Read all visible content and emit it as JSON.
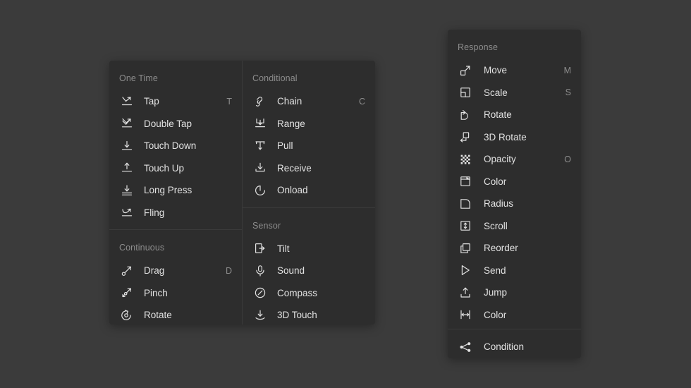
{
  "theme": {
    "background": "#3b3b3b",
    "panel": "#2d2d2d",
    "divider": "#3b3b3b",
    "label_color": "#e2e2e2",
    "muted_color": "#8d8d8d",
    "icon_color": "#e2e2e2"
  },
  "left_panel": {
    "columns": [
      {
        "sections": [
          {
            "title": "One Time",
            "items": [
              {
                "label": "Tap",
                "shortcut": "T",
                "icon": "tap-icon"
              },
              {
                "label": "Double Tap",
                "shortcut": "",
                "icon": "double-tap-icon"
              },
              {
                "label": "Touch Down",
                "shortcut": "",
                "icon": "touch-down-icon"
              },
              {
                "label": "Touch Up",
                "shortcut": "",
                "icon": "touch-up-icon"
              },
              {
                "label": "Long Press",
                "shortcut": "",
                "icon": "long-press-icon"
              },
              {
                "label": "Fling",
                "shortcut": "",
                "icon": "fling-icon"
              }
            ]
          },
          {
            "title": "Continuous",
            "items": [
              {
                "label": "Drag",
                "shortcut": "D",
                "icon": "drag-icon"
              },
              {
                "label": "Pinch",
                "shortcut": "",
                "icon": "pinch-icon"
              },
              {
                "label": "Rotate",
                "shortcut": "",
                "icon": "rotate-gesture-icon"
              }
            ]
          }
        ]
      },
      {
        "sections": [
          {
            "title": "Conditional",
            "items": [
              {
                "label": "Chain",
                "shortcut": "C",
                "icon": "chain-icon"
              },
              {
                "label": "Range",
                "shortcut": "",
                "icon": "range-icon"
              },
              {
                "label": "Pull",
                "shortcut": "",
                "icon": "pull-icon"
              },
              {
                "label": "Receive",
                "shortcut": "",
                "icon": "receive-icon"
              },
              {
                "label": "Onload",
                "shortcut": "",
                "icon": "onload-icon"
              }
            ]
          },
          {
            "title": "Sensor",
            "items": [
              {
                "label": "Tilt",
                "shortcut": "",
                "icon": "tilt-icon"
              },
              {
                "label": "Sound",
                "shortcut": "",
                "icon": "microphone-icon"
              },
              {
                "label": "Compass",
                "shortcut": "",
                "icon": "compass-icon"
              },
              {
                "label": "3D Touch",
                "shortcut": "",
                "icon": "three-d-touch-icon"
              }
            ]
          }
        ]
      }
    ]
  },
  "right_panel": {
    "section_title": "Response",
    "items": [
      {
        "label": "Move",
        "shortcut": "M",
        "icon": "move-icon"
      },
      {
        "label": "Scale",
        "shortcut": "S",
        "icon": "scale-icon"
      },
      {
        "label": "Rotate",
        "shortcut": "",
        "icon": "rotate-icon"
      },
      {
        "label": "3D Rotate",
        "shortcut": "",
        "icon": "three-d-rotate-icon"
      },
      {
        "label": "Opacity",
        "shortcut": "O",
        "icon": "opacity-icon"
      },
      {
        "label": "Color",
        "shortcut": "",
        "icon": "color-fill-icon"
      },
      {
        "label": "Radius",
        "shortcut": "",
        "icon": "radius-icon"
      },
      {
        "label": "Scroll",
        "shortcut": "",
        "icon": "scroll-icon"
      },
      {
        "label": "Reorder",
        "shortcut": "",
        "icon": "reorder-icon"
      },
      {
        "label": "Send",
        "shortcut": "",
        "icon": "send-icon"
      },
      {
        "label": "Jump",
        "shortcut": "",
        "icon": "jump-icon"
      },
      {
        "label": "Color",
        "shortcut": "",
        "icon": "color-width-icon"
      }
    ],
    "footer": {
      "label": "Condition",
      "shortcut": "",
      "icon": "condition-icon"
    }
  }
}
